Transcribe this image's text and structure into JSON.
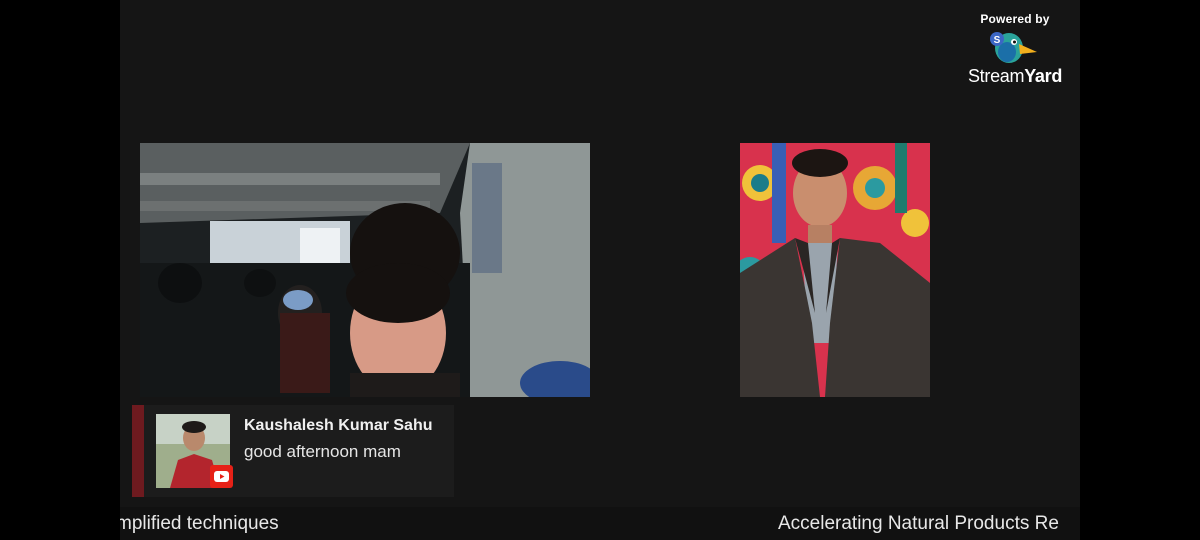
{
  "branding": {
    "powered_by": "Powered by",
    "wordmark_light": "Stream",
    "wordmark_bold": "Yard",
    "logo_icon": "streamyard-duck-icon"
  },
  "participants": [
    {
      "role": "camera-feed-left",
      "scene": "classroom"
    },
    {
      "role": "camera-feed-right",
      "scene": "speaker-in-suit"
    }
  ],
  "comment": {
    "author": "Kaushalesh Kumar Sahu",
    "message": "good afternoon mam",
    "platform_icon": "youtube-icon",
    "accent_color": "#6e1a1f"
  },
  "ticker": {
    "left_text": "mplified techniques",
    "right_text": "Accelerating Natural Products Re"
  },
  "colors": {
    "background": "#151515",
    "youtube_red": "#e62117"
  }
}
